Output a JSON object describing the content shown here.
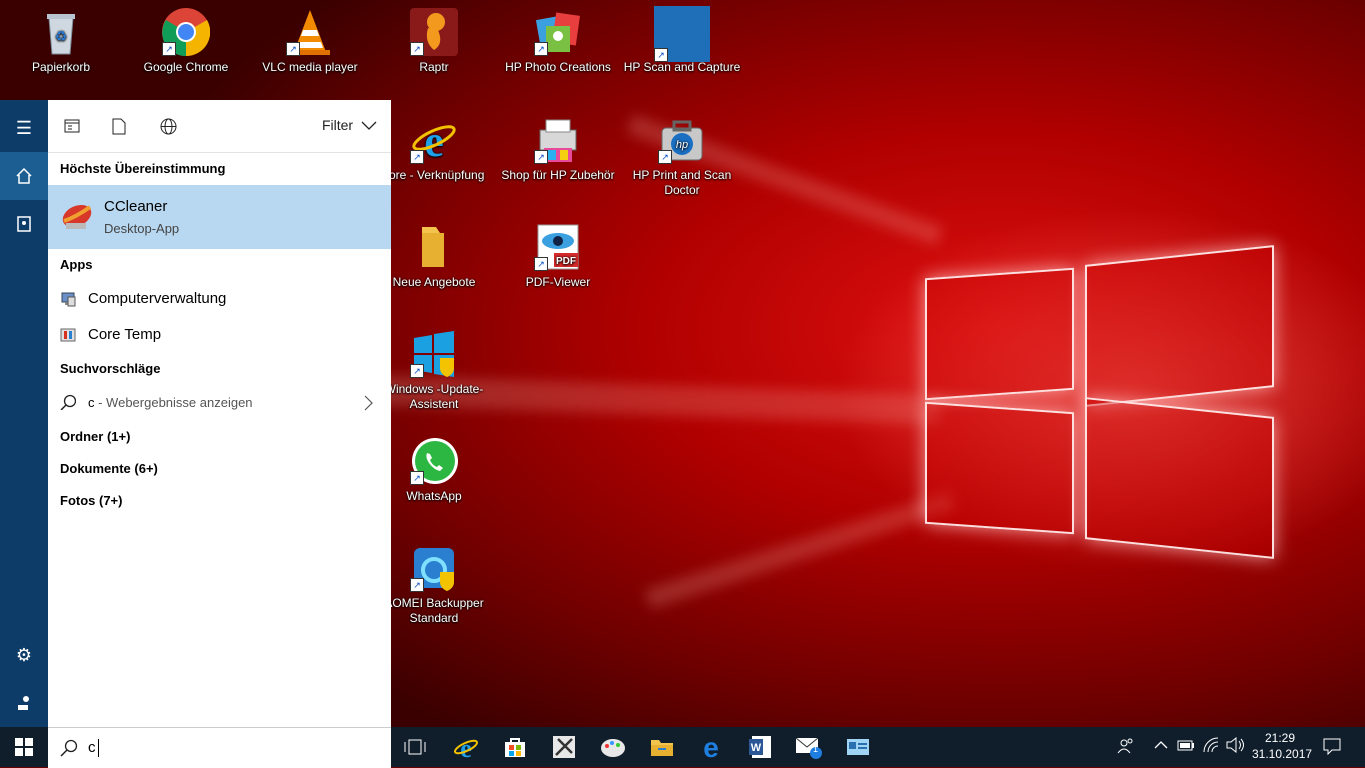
{
  "desktop_icons": [
    {
      "id": "recycle-bin",
      "label": "Papierkorb"
    },
    {
      "id": "chrome",
      "label": "Google Chrome"
    },
    {
      "id": "vlc",
      "label": "VLC media player"
    },
    {
      "id": "raptr",
      "label": "Raptr"
    },
    {
      "id": "hp-photo",
      "label": "HP Photo Creations"
    },
    {
      "id": "hp-scan",
      "label": "HP Scan and Capture"
    },
    {
      "id": "ie",
      "label": "plore - Verknüpfung"
    },
    {
      "id": "hp-shop",
      "label": "Shop für HP Zubehör"
    },
    {
      "id": "hp-print-doctor",
      "label": "HP Print and Scan Doctor"
    },
    {
      "id": "neue-angebote",
      "label": "Neue Angebote"
    },
    {
      "id": "pdf-viewer",
      "label": "PDF-Viewer"
    },
    {
      "id": "win-update",
      "label": "Windows -Update-Assistent"
    },
    {
      "id": "whatsapp",
      "label": "WhatsApp"
    },
    {
      "id": "aomei",
      "label": "AOMEI Backupper Standard"
    }
  ],
  "search_panel": {
    "filter_label": "Filter",
    "best_match_heading": "Höchste Übereinstimmung",
    "best_match": {
      "name": "CCleaner",
      "type": "Desktop-App"
    },
    "apps_heading": "Apps",
    "apps": [
      {
        "label": "Computerverwaltung"
      },
      {
        "label": "Core Temp"
      }
    ],
    "suggestions_heading": "Suchvorschläge",
    "suggestion": {
      "query": "c",
      "text": " - Webergebnisse anzeigen"
    },
    "categories": [
      {
        "label": "Ordner (1+)"
      },
      {
        "label": "Dokumente (6+)"
      },
      {
        "label": "Fotos (7+)"
      }
    ]
  },
  "search_box": {
    "value": "c"
  },
  "taskbar": {
    "time": "21:29",
    "date": "31.10.2017",
    "mail_badge": "1"
  }
}
